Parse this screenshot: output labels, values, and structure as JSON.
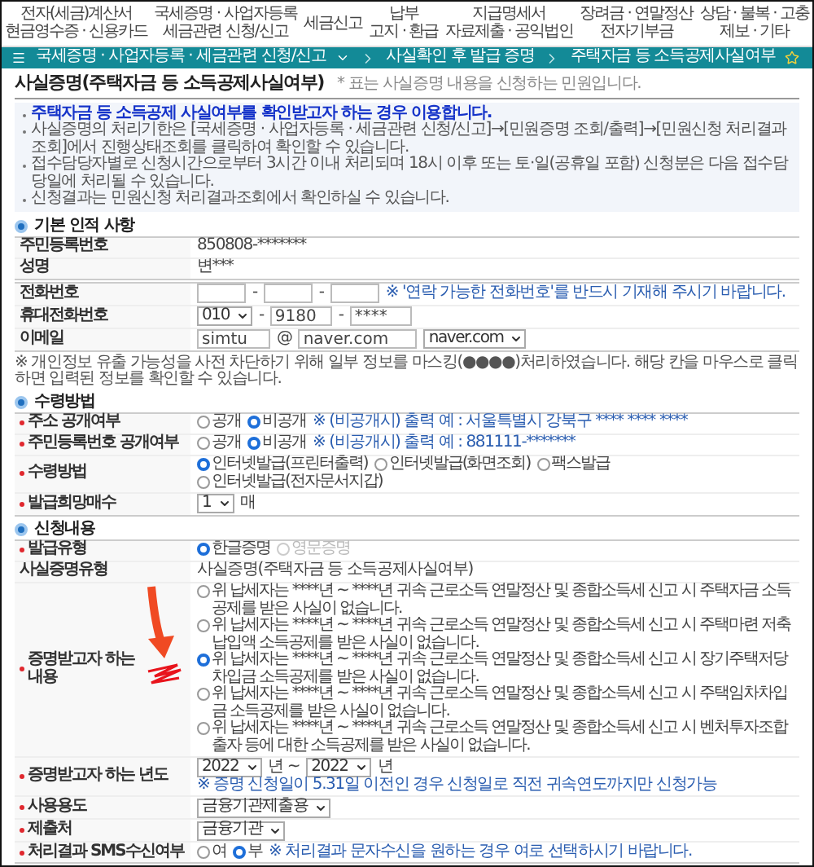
{
  "nav": [
    {
      "lines": [
        "전자(세금)계산서",
        "현금영수증 · 신용카드"
      ]
    },
    {
      "lines": [
        "국세증명 · 사업자등록",
        "세금관련 신청/신고"
      ]
    },
    {
      "lines": [
        "세금신고"
      ]
    },
    {
      "lines": [
        "납부",
        "고지 · 환급"
      ]
    },
    {
      "lines": [
        "지급명세서",
        "자료제출 · 공익법인"
      ]
    },
    {
      "lines": [
        "장려금 · 연말정산",
        "전자기부금"
      ]
    },
    {
      "lines": [
        "상담 · 불복 · 고충",
        "제보 · 기타"
      ]
    }
  ],
  "breadcrumb": {
    "menu": "국세증명 · 사업자등록 · 세금관련 신청/신고",
    "items": [
      "사실확인 후 발급 증명",
      "주택자금 등 소득공제사실여부"
    ]
  },
  "page_title": "사실증명(주택자금 등 소득공제사실여부)",
  "title_note": "* 표는 사실증명 내용을 신청하는 민원입니다.",
  "notice": [
    {
      "text": "주택자금 등 소득공제 사실여부를 확인받고자 하는 경우 이용합니다.",
      "emphasis": true
    },
    {
      "text": "사실증명의 처리기한은 [국세증명 · 사업자등록 · 세금관련 신청/신고]→[민원증명 조회/출력]→[민원신청 처리결과 조회]에서 진행상태조회를 클릭하여 확인할 수 있습니다.",
      "emphasis": false
    },
    {
      "text": "접수담당자별로 신청시간으로부터 3시간 이내 처리되며 18시 이후 또는 토·일(공휴일 포함) 신청분은 다음 접수담당일에 처리될 수 있습니다.",
      "emphasis": false
    },
    {
      "text": "신청결과는 민원신청 처리결과조회에서 확인하실 수 있습니다.",
      "emphasis": false
    }
  ],
  "sections": [
    {
      "title": "기본 인적 사항",
      "tables": [
        {
          "rows": [
            {
              "label": "주민등록번호",
              "required": false,
              "parts": [
                {
                  "kind": "text",
                  "text": "850808-*******"
                }
              ]
            },
            {
              "label": "성명",
              "required": false,
              "parts": [
                {
                  "kind": "text",
                  "text": "변***"
                }
              ]
            }
          ]
        },
        {
          "rows": [
            {
              "label": "전화번호",
              "required": false,
              "parts": [
                {
                  "kind": "input"
                },
                {
                  "kind": "text",
                  "text": "-"
                },
                {
                  "kind": "input"
                },
                {
                  "kind": "text",
                  "text": "-"
                },
                {
                  "kind": "input"
                },
                {
                  "kind": "note",
                  "text": "※ '연락 가능한 전화번호'를 반드시 기재해 주시기 바랍니다."
                }
              ]
            },
            {
              "label": "휴대전화번호",
              "required": false,
              "parts": [
                {
                  "kind": "select",
                  "value": "010"
                },
                {
                  "kind": "text",
                  "text": "-"
                },
                {
                  "kind": "input",
                  "value": "9180"
                },
                {
                  "kind": "text",
                  "text": "-"
                },
                {
                  "kind": "input",
                  "value": "****"
                }
              ]
            },
            {
              "label": "이메일",
              "required": false,
              "parts": [
                {
                  "kind": "input",
                  "value": "simtu"
                },
                {
                  "kind": "text",
                  "text": "@"
                },
                {
                  "kind": "input",
                  "value": "naver.com"
                },
                {
                  "kind": "select",
                  "value": "naver.com"
                }
              ]
            }
          ]
        }
      ],
      "note": "※ 개인정보 유출 가능성을 사전 차단하기 위해 일부 정보를 마스킹(●●●●)처리하였습니다. 해당 칸을 마우스로 클릭하면 입력된 정보를 확인할 수 있습니다."
    },
    {
      "title": "수령방법",
      "tables": [
        {
          "rows": [
            {
              "label": "주소 공개여부",
              "required": true,
              "parts": [
                {
                  "kind": "radio",
                  "label": "공개",
                  "selected": false
                },
                {
                  "kind": "radio",
                  "label": "비공개",
                  "selected": true
                },
                {
                  "kind": "note",
                  "text": "※ (비공개시) 출력 예 : 서울특별시 강북구 **** **** ****"
                }
              ]
            },
            {
              "label": "주민등록번호 공개여부",
              "required": true,
              "parts": [
                {
                  "kind": "radio",
                  "label": "공개",
                  "selected": false
                },
                {
                  "kind": "radio",
                  "label": "비공개",
                  "selected": true
                },
                {
                  "kind": "note",
                  "text": "※ (비공개시) 출력 예 : 881111-*******"
                }
              ]
            },
            {
              "label": "수령방법",
              "required": true,
              "parts": [
                {
                  "kind": "radio",
                  "label": "인터넷발급(프린터출력)",
                  "selected": true
                },
                {
                  "kind": "radio",
                  "label": "인터넷발급(화면조회)",
                  "selected": false
                },
                {
                  "kind": "radio",
                  "label": "팩스발급",
                  "selected": false
                },
                {
                  "kind": "radio",
                  "label": "인터넷발급(전자문서지갑)",
                  "selected": false
                }
              ]
            },
            {
              "label": "발급희망매수",
              "required": true,
              "parts": [
                {
                  "kind": "select",
                  "value": "1"
                },
                {
                  "kind": "text",
                  "text": "매"
                }
              ]
            }
          ]
        }
      ]
    },
    {
      "title": "신청내용",
      "tables": [
        {
          "rows": [
            {
              "label": "발급유형",
              "required": true,
              "parts": [
                {
                  "kind": "radio",
                  "label": "한글증명",
                  "selected": true,
                  "disabled": false
                },
                {
                  "kind": "radio",
                  "label": "영문증명",
                  "selected": false,
                  "disabled": true
                }
              ]
            },
            {
              "label": "사실증명유형",
              "required": false,
              "parts": [
                {
                  "kind": "text",
                  "text": "사실증명(주택자금 등 소득공제사실여부)"
                }
              ]
            },
            {
              "label": "증명받고자 하는 내용",
              "required": true,
              "marked": true,
              "parts": [
                {
                  "kind": "option",
                  "label": "위 납세자는 ****년 ~ ****년 귀속 근로소득 연말정산 및 종합소득세 신고 시 주택자금 소득공제를 받은 사실이 없습니다.",
                  "selected": false
                },
                {
                  "kind": "option",
                  "label": "위 납세자는 ****년 ~ ****년 귀속 근로소득 연말정산 및 종합소득세 신고 시 주택마련 저축 납입액 소득공제를 받은 사실이 없습니다.",
                  "selected": false
                },
                {
                  "kind": "option",
                  "label": "위 납세자는 ****년 ~ ****년 귀속 근로소득 연말정산 및 종합소득세 신고 시 장기주택저당차입금 소득공제를 받은 사실이 없습니다.",
                  "selected": true
                },
                {
                  "kind": "option",
                  "label": "위 납세자는 ****년 ~ ****년 귀속 근로소득 연말정산 및 종합소득세 신고 시 주택임차차입금 소득공제를 받은 사실이 없습니다.",
                  "selected": false
                },
                {
                  "kind": "option",
                  "label": "위 납세자는 ****년 ~ ****년 귀속 근로소득 연말정산 및 종합소득세 신고 시 벤처투자조합 출자 등에 대한 소득공제를 받은 사실이 없습니다.",
                  "selected": false
                }
              ]
            },
            {
              "label": "증명받고자 하는 년도",
              "required": true,
              "parts": [
                {
                  "kind": "select",
                  "value": "2022"
                },
                {
                  "kind": "text",
                  "text": "년 ~"
                },
                {
                  "kind": "select",
                  "value": "2022"
                },
                {
                  "kind": "text",
                  "text": "년"
                },
                {
                  "kind": "note",
                  "text": "※ 증명 신청일이 5.31일 이전인 경우 신청일로 직전 귀속연도까지만 신청가능"
                }
              ]
            },
            {
              "label": "사용용도",
              "required": true,
              "parts": [
                {
                  "kind": "select",
                  "value": "금융기관제출용"
                }
              ]
            },
            {
              "label": "제출처",
              "required": true,
              "parts": [
                {
                  "kind": "select",
                  "value": "금융기관"
                }
              ]
            },
            {
              "label": "처리결과 SMS수신여부",
              "required": true,
              "parts": [
                {
                  "kind": "radio",
                  "label": "여",
                  "selected": false
                },
                {
                  "kind": "radio",
                  "label": "부",
                  "selected": true
                },
                {
                  "kind": "note",
                  "text": "※ 처리결과 문자수신을 원하는 경우 여로 선택하시기 바랍니다."
                }
              ]
            }
          ]
        }
      ]
    }
  ]
}
